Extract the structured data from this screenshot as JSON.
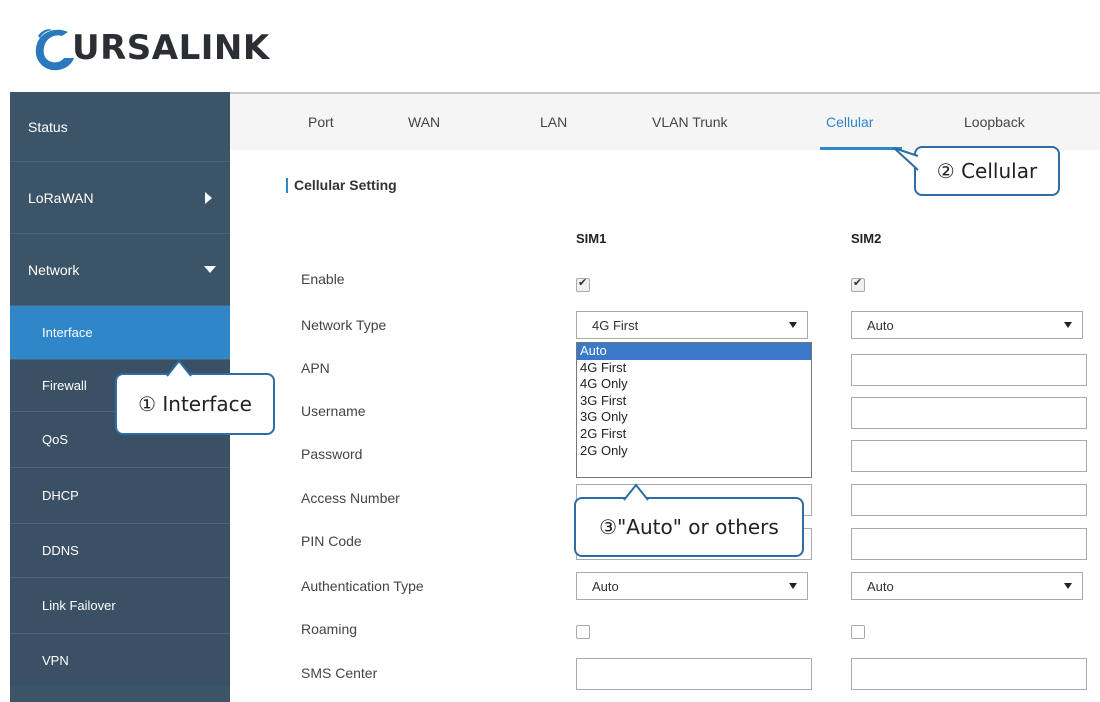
{
  "brand": {
    "logo_text": "URSALINK"
  },
  "colors": {
    "sidebar": "#3c5468",
    "active": "#2f86c8",
    "callout_border": "#2e6da4"
  },
  "sidebar": {
    "items": [
      {
        "label": "Status"
      },
      {
        "label": "LoRaWAN",
        "icon": "triangle-right-icon"
      },
      {
        "label": "Network",
        "icon": "triangle-down-icon"
      },
      {
        "label": "Interface",
        "active": true
      },
      {
        "label": "Firewall"
      },
      {
        "label": "QoS"
      },
      {
        "label": "DHCP"
      },
      {
        "label": "DDNS"
      },
      {
        "label": "Link Failover"
      },
      {
        "label": "VPN"
      }
    ]
  },
  "tabs": [
    {
      "label": "Port"
    },
    {
      "label": "WAN"
    },
    {
      "label": "LAN"
    },
    {
      "label": "VLAN Trunk"
    },
    {
      "label": "Cellular",
      "active": true
    },
    {
      "label": "Loopback"
    }
  ],
  "section": {
    "title": "Cellular Setting"
  },
  "columns": {
    "sim1": "SIM1",
    "sim2": "SIM2"
  },
  "fields": {
    "enable": "Enable",
    "network_type": "Network Type",
    "apn": "APN",
    "username": "Username",
    "password": "Password",
    "access_number": "Access Number",
    "pin_code": "PIN Code",
    "auth_type": "Authentication Type",
    "roaming": "Roaming",
    "sms_center": "SMS Center"
  },
  "values": {
    "sim1_enable": true,
    "sim2_enable": true,
    "sim1_network_type": "4G First",
    "sim2_network_type": "Auto",
    "sim1_auth_type": "Auto",
    "sim2_auth_type": "Auto",
    "sim1_roaming": false,
    "sim2_roaming": false
  },
  "dropdown": {
    "options": [
      "Auto",
      "4G First",
      "4G Only",
      "3G First",
      "3G Only",
      "2G First",
      "2G Only"
    ],
    "highlighted": "Auto"
  },
  "callouts": {
    "interface": "① Interface",
    "cellular": "② Cellular",
    "auto": "③\"Auto\" or others"
  }
}
